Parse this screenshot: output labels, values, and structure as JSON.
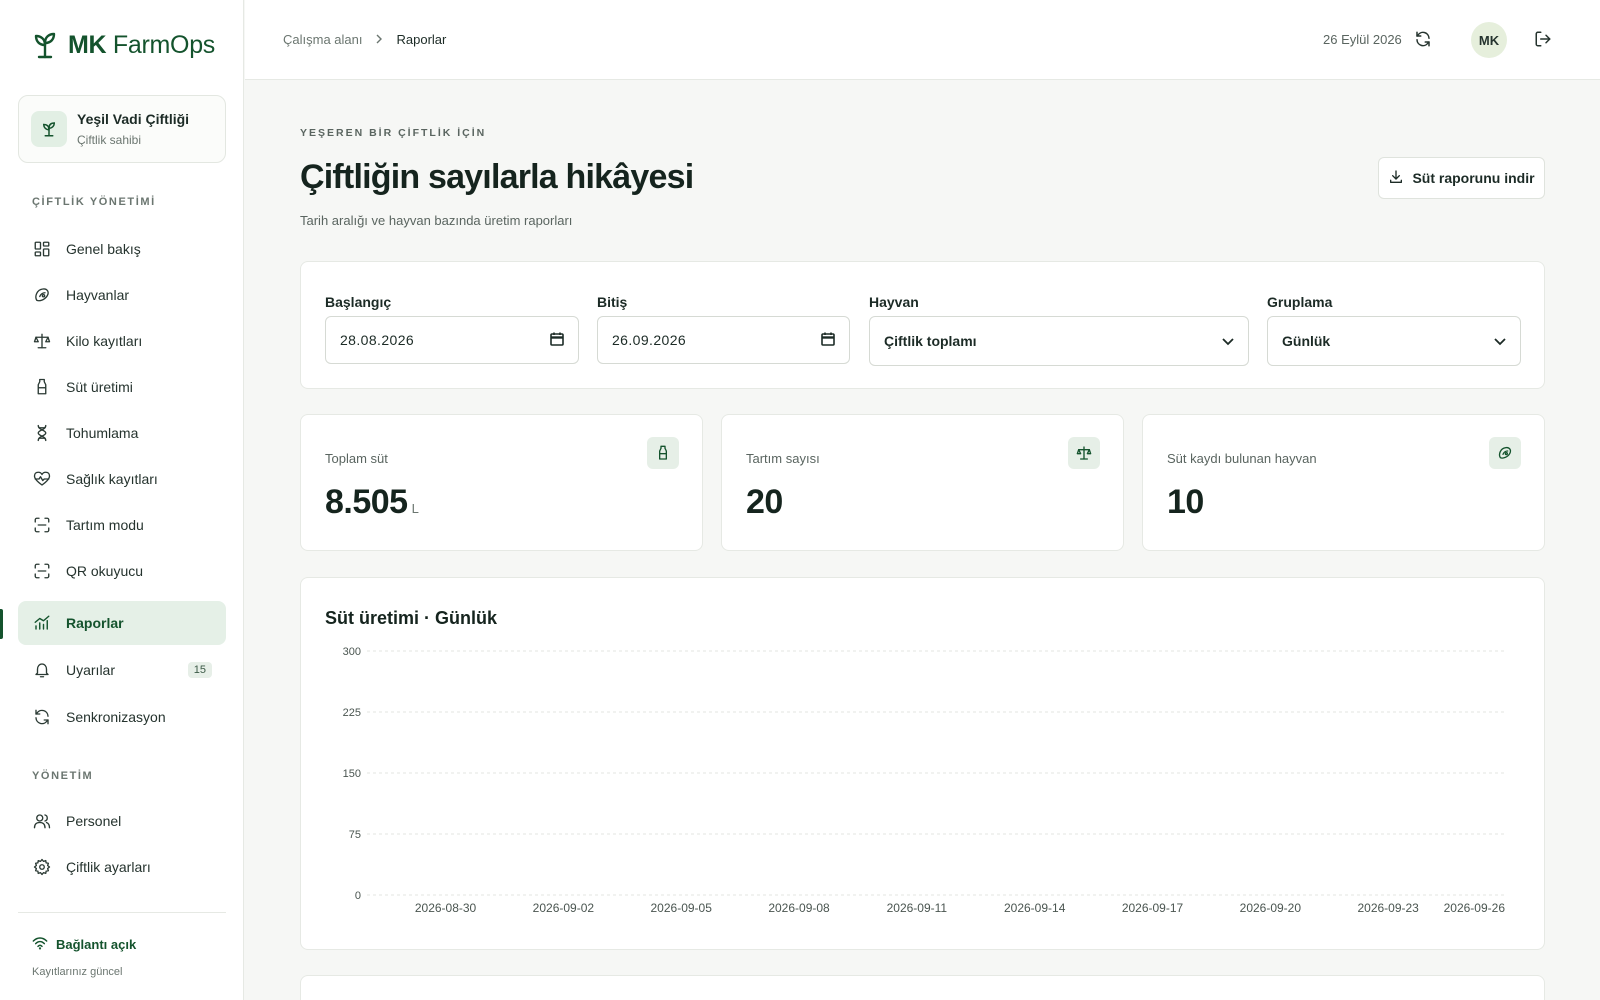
{
  "brand": {
    "bold": "MK",
    "rest": " FarmOps"
  },
  "farm": {
    "name": "Yeşil Vadi Çiftliği",
    "role": "Çiftlik sahibi"
  },
  "sidebar": {
    "section1": "ÇİFTLİK YÖNETİMİ",
    "section2": "YÖNETİM",
    "items": [
      {
        "label": "Genel bakış",
        "icon": "dashboard-icon"
      },
      {
        "label": "Hayvanlar",
        "icon": "animal-icon"
      },
      {
        "label": "Kilo kayıtları",
        "icon": "scale-icon"
      },
      {
        "label": "Süt üretimi",
        "icon": "milk-bottle-icon"
      },
      {
        "label": "Tohumlama",
        "icon": "dna-icon"
      },
      {
        "label": "Sağlık kayıtları",
        "icon": "heart-pulse-icon"
      },
      {
        "label": "Tartım modu",
        "icon": "scan-icon"
      },
      {
        "label": "QR okuyucu",
        "icon": "qr-scan-icon"
      },
      {
        "label": "Raporlar",
        "icon": "chart-icon"
      },
      {
        "label": "Uyarılar",
        "icon": "bell-icon",
        "badge": "15"
      },
      {
        "label": "Senkronizasyon",
        "icon": "sync-icon"
      }
    ],
    "admin_items": [
      {
        "label": "Personel",
        "icon": "users-icon"
      },
      {
        "label": "Çiftlik ayarları",
        "icon": "gear-icon"
      }
    ],
    "connection": {
      "label": "Bağlantı açık",
      "sub": "Kayıtlarınız güncel"
    }
  },
  "topbar": {
    "crumbs": [
      "Çalışma alanı",
      "Raporlar"
    ],
    "date": "26 Eylül 2026",
    "avatar": "MK"
  },
  "page": {
    "eyebrow": "YEŞEREN BİR ÇİFTLİK İÇİN",
    "title": "Çiftliğin sayılarla hikâyesi",
    "subtitle": "Tarih aralığı ve hayvan bazında üretim raporları",
    "download_label": "Süt raporunu indir"
  },
  "filters": {
    "start": {
      "label": "Başlangıç",
      "value": "28.08.2026"
    },
    "end": {
      "label": "Bitiş",
      "value": "26.09.2026"
    },
    "animal": {
      "label": "Hayvan",
      "value": "Çiftlik toplamı"
    },
    "grouping": {
      "label": "Gruplama",
      "value": "Günlük"
    }
  },
  "stats": [
    {
      "label": "Toplam süt",
      "value": "8.505",
      "unit": "L",
      "icon": "milk-bottle-icon"
    },
    {
      "label": "Tartım sayısı",
      "value": "20",
      "unit": "",
      "icon": "scale-icon"
    },
    {
      "label": "Süt kaydı bulunan hayvan",
      "value": "10",
      "unit": "",
      "icon": "animal-icon"
    }
  ],
  "chart_data": {
    "type": "line",
    "title": "Süt üretimi · Günlük",
    "ylim": [
      0,
      300
    ],
    "yticks": [
      0,
      75,
      150,
      225,
      300
    ],
    "xticks": [
      "2026-08-30",
      "2026-09-02",
      "2026-09-05",
      "2026-09-08",
      "2026-09-11",
      "2026-09-14",
      "2026-09-17",
      "2026-09-20",
      "2026-09-23",
      "2026-09-26"
    ],
    "x_start": "2026-08-28",
    "x_end": "2026-09-26",
    "grid": true,
    "series": []
  },
  "colors": {
    "brand": "#14532d",
    "accent_bg": "#e5f0e7"
  }
}
